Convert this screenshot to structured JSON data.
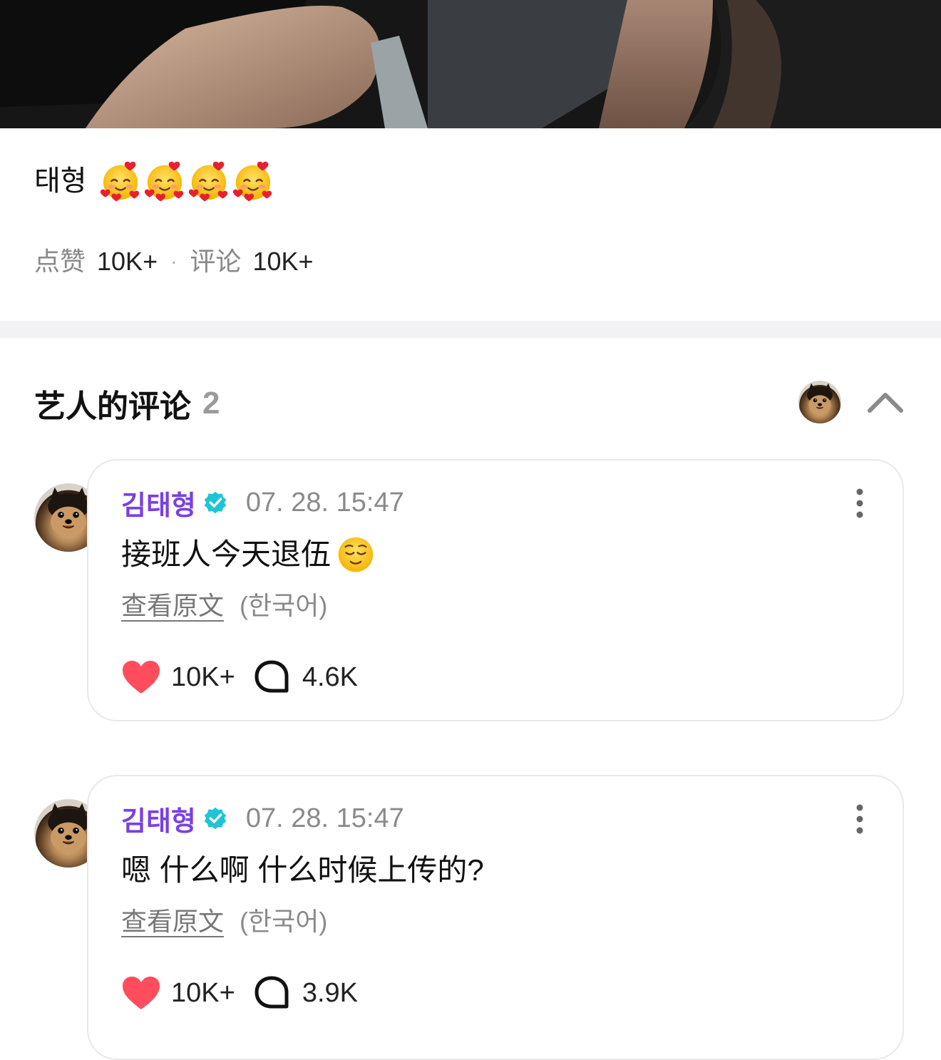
{
  "post": {
    "caption_text": "태형",
    "caption_emoji": "smiling-face-with-hearts-icon",
    "caption_emoji_count": 4
  },
  "stats": {
    "likes_label": "点赞",
    "likes_value": "10K+",
    "separator": "·",
    "comments_label": "评论",
    "comments_value": "10K+"
  },
  "artist_comments": {
    "title": "艺人的评论",
    "count": "2",
    "collapse_icon": "chevron-up-icon"
  },
  "comments": [
    {
      "author": "김태형",
      "verified_icon": "verified-badge-icon",
      "time": "07. 28. 15:47",
      "text": "接班人今天退伍",
      "text_emoji": "relieved-face-icon",
      "translate_link": "查看原文",
      "translate_lang": "(한국어)",
      "likes": "10K+",
      "replies": "4.6K"
    },
    {
      "author": "김태형",
      "verified_icon": "verified-badge-icon",
      "time": "07. 28. 15:47",
      "text": "嗯 什么啊 什么时候上传的?",
      "text_emoji": "",
      "translate_link": "查看原文",
      "translate_lang": "(한국어)",
      "likes": "10K+",
      "replies": "3.9K"
    }
  ],
  "colors": {
    "author": "#7b3fe4",
    "verified": "#1fc4d6",
    "like": "#ff4d5e",
    "divider": "#f2f2f4",
    "card_border": "#e8e8ee"
  }
}
